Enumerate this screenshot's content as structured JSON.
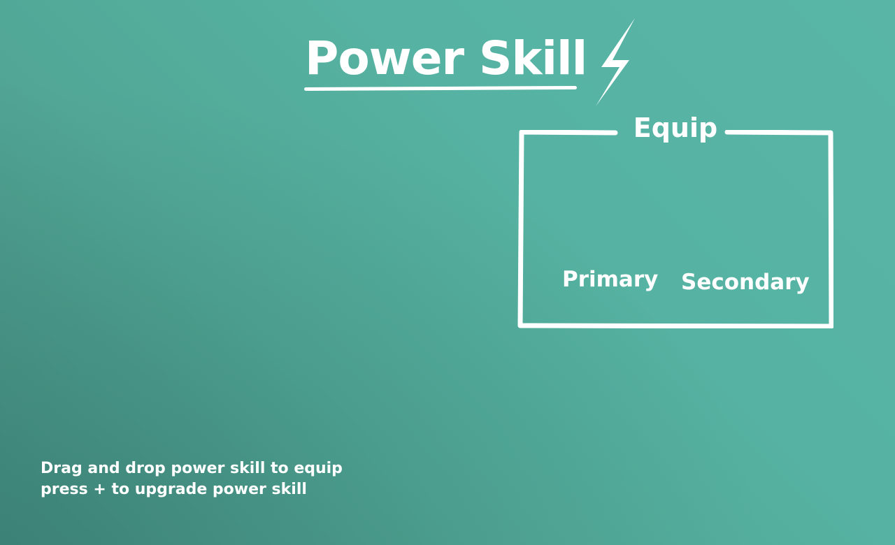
{
  "header": {
    "title": "Power Skill",
    "icon": "lightning-bolt-icon"
  },
  "equip": {
    "title": "Equip",
    "slots": [
      {
        "label": "Primary"
      },
      {
        "label": "Secondary"
      }
    ]
  },
  "instructions": {
    "line1": "Drag and drop power skill to equip",
    "line2": "press + to upgrade power skill"
  },
  "colors": {
    "background_light": "#59b6a6",
    "background_dark": "#478c80",
    "foreground": "#ffffff"
  }
}
